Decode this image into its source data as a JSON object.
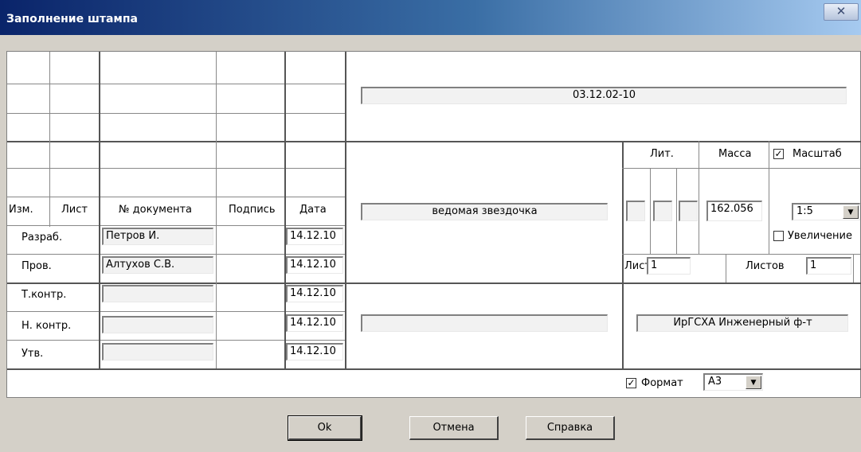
{
  "window": {
    "title": "Заполнение штампа",
    "close_icon": "close-icon"
  },
  "stamp": {
    "designation": "03.12.02-10",
    "name": "ведомая звездочка",
    "extra": "",
    "organization": "ИрГСХА Инженерный ф-т"
  },
  "headers": {
    "izm": "Изм.",
    "list": "Лист",
    "doc_no": "№ документа",
    "signature": "Подпись",
    "date": "Дата"
  },
  "rows": [
    {
      "role": "Разраб.",
      "surname": "Петров И.",
      "date": "14.12.10"
    },
    {
      "role": "Пров.",
      "surname": "Алтухов С.В.",
      "date": "14.12.10"
    },
    {
      "role": "Т.контр.",
      "surname": "",
      "date": "14.12.10"
    },
    {
      "role": "Н. контр.",
      "surname": "",
      "date": "14.12.10"
    },
    {
      "role": "Утв.",
      "surname": "",
      "date": "14.12.10"
    }
  ],
  "lit": {
    "label": "Лит.",
    "values": [
      "",
      "",
      ""
    ]
  },
  "mass": {
    "label": "Масса",
    "value": "162.056"
  },
  "scale": {
    "label": "Масштаб",
    "checked": true,
    "value": "1:5",
    "zoom_label": "Увеличение",
    "zoom_checked": false
  },
  "sheet": {
    "label": "Лист",
    "value": "1",
    "total_label": "Листов",
    "total_value": "1"
  },
  "format": {
    "label": "Формат",
    "checked": true,
    "value": "А3"
  },
  "buttons": {
    "ok": "Ok",
    "cancel": "Отмена",
    "help": "Справка"
  }
}
